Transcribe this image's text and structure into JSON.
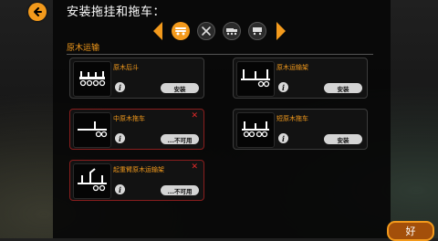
{
  "title": "安装拖挂和拖车：",
  "back_icon": "back-arrow-icon",
  "tabs": [
    {
      "icon": "log-trailer-icon",
      "active": true
    },
    {
      "icon": "tools-icon",
      "active": false
    },
    {
      "icon": "truck-trailer-icon",
      "active": false
    },
    {
      "icon": "cargo-trailer-icon",
      "active": false
    }
  ],
  "section_title": "原木运输",
  "cards": [
    {
      "name": "原木后斗",
      "action": "安装",
      "status": "available"
    },
    {
      "name": "原木运输架",
      "action": "安装",
      "status": "available"
    },
    {
      "name": "中原木拖车",
      "action": "...不可用",
      "status": "unavailable"
    },
    {
      "name": "短原木拖车",
      "action": "安装",
      "status": "available"
    },
    {
      "name": "起重臂原木运输架",
      "action": "...不可用",
      "status": "unavailable"
    }
  ],
  "info_glyph": "i",
  "close_glyph": "✕",
  "ok_button": "好",
  "colors": {
    "accent": "#f39a1c",
    "unavailable_border": "#8a1e1e",
    "close": "#e02a2a"
  }
}
